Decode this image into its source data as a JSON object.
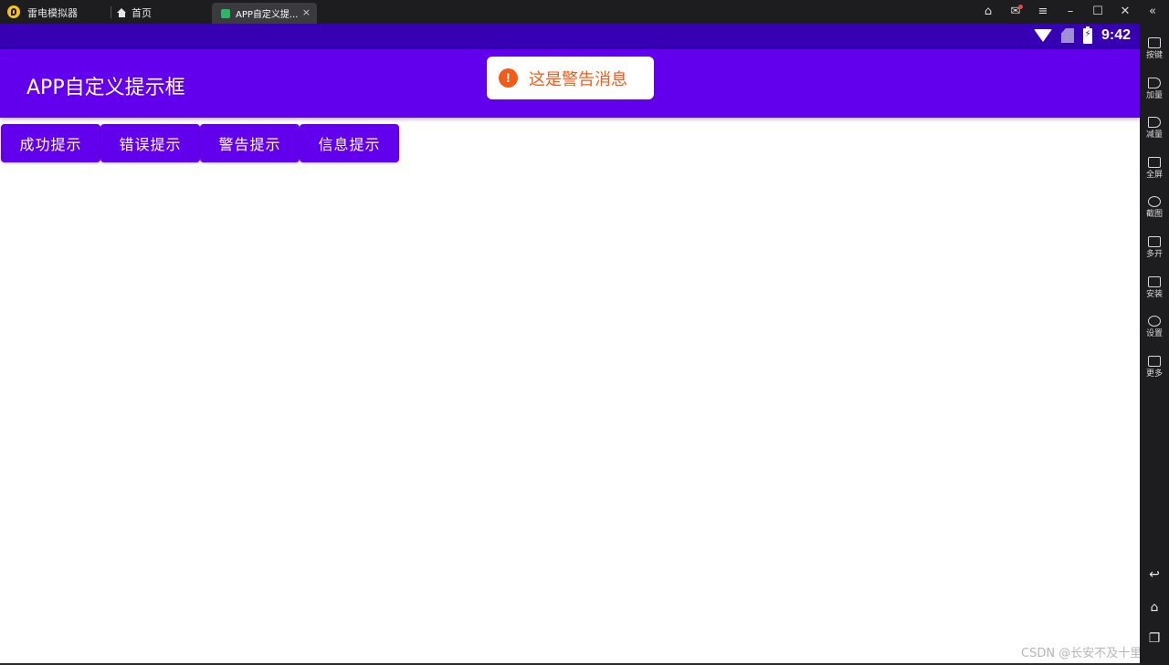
{
  "emulator": {
    "app_name": "雷电模拟器",
    "home_tab_label": "首页",
    "active_tab_label": "APP自定义提...",
    "tab_close_glyph": "×",
    "window_controls": [
      "gamepad-icon",
      "mail-icon",
      "menu-icon",
      "minimize-icon",
      "maximize-icon",
      "close-icon",
      "collapse-icon"
    ],
    "sidebar": [
      {
        "label": "按键",
        "icon": "keyboard-icon"
      },
      {
        "label": "加量",
        "icon": "volume-up-icon"
      },
      {
        "label": "减量",
        "icon": "volume-down-icon"
      },
      {
        "label": "全屏",
        "icon": "fullscreen-icon"
      },
      {
        "label": "截图",
        "icon": "scissors-icon"
      },
      {
        "label": "多开",
        "icon": "multi-instance-icon"
      },
      {
        "label": "安装",
        "icon": "apk-icon"
      },
      {
        "label": "设置",
        "icon": "settings-icon"
      },
      {
        "label": "更多",
        "icon": "more-icon"
      }
    ],
    "nav_buttons": [
      "back-icon",
      "home-icon",
      "recents-icon"
    ]
  },
  "android": {
    "status_time": "9:42",
    "app_title": "APP自定义提示框",
    "toast": {
      "message": "这是警告消息",
      "icon_glyph": "!",
      "color": "#f25c19"
    },
    "buttons": [
      {
        "label": "成功提示"
      },
      {
        "label": "错误提示"
      },
      {
        "label": "警告提示"
      },
      {
        "label": "信息提示"
      }
    ],
    "colors": {
      "status_bar": "#3700b3",
      "app_bar": "#6200ee",
      "button": "#6200ee"
    }
  },
  "watermark": "CSDN @长安不及十里"
}
